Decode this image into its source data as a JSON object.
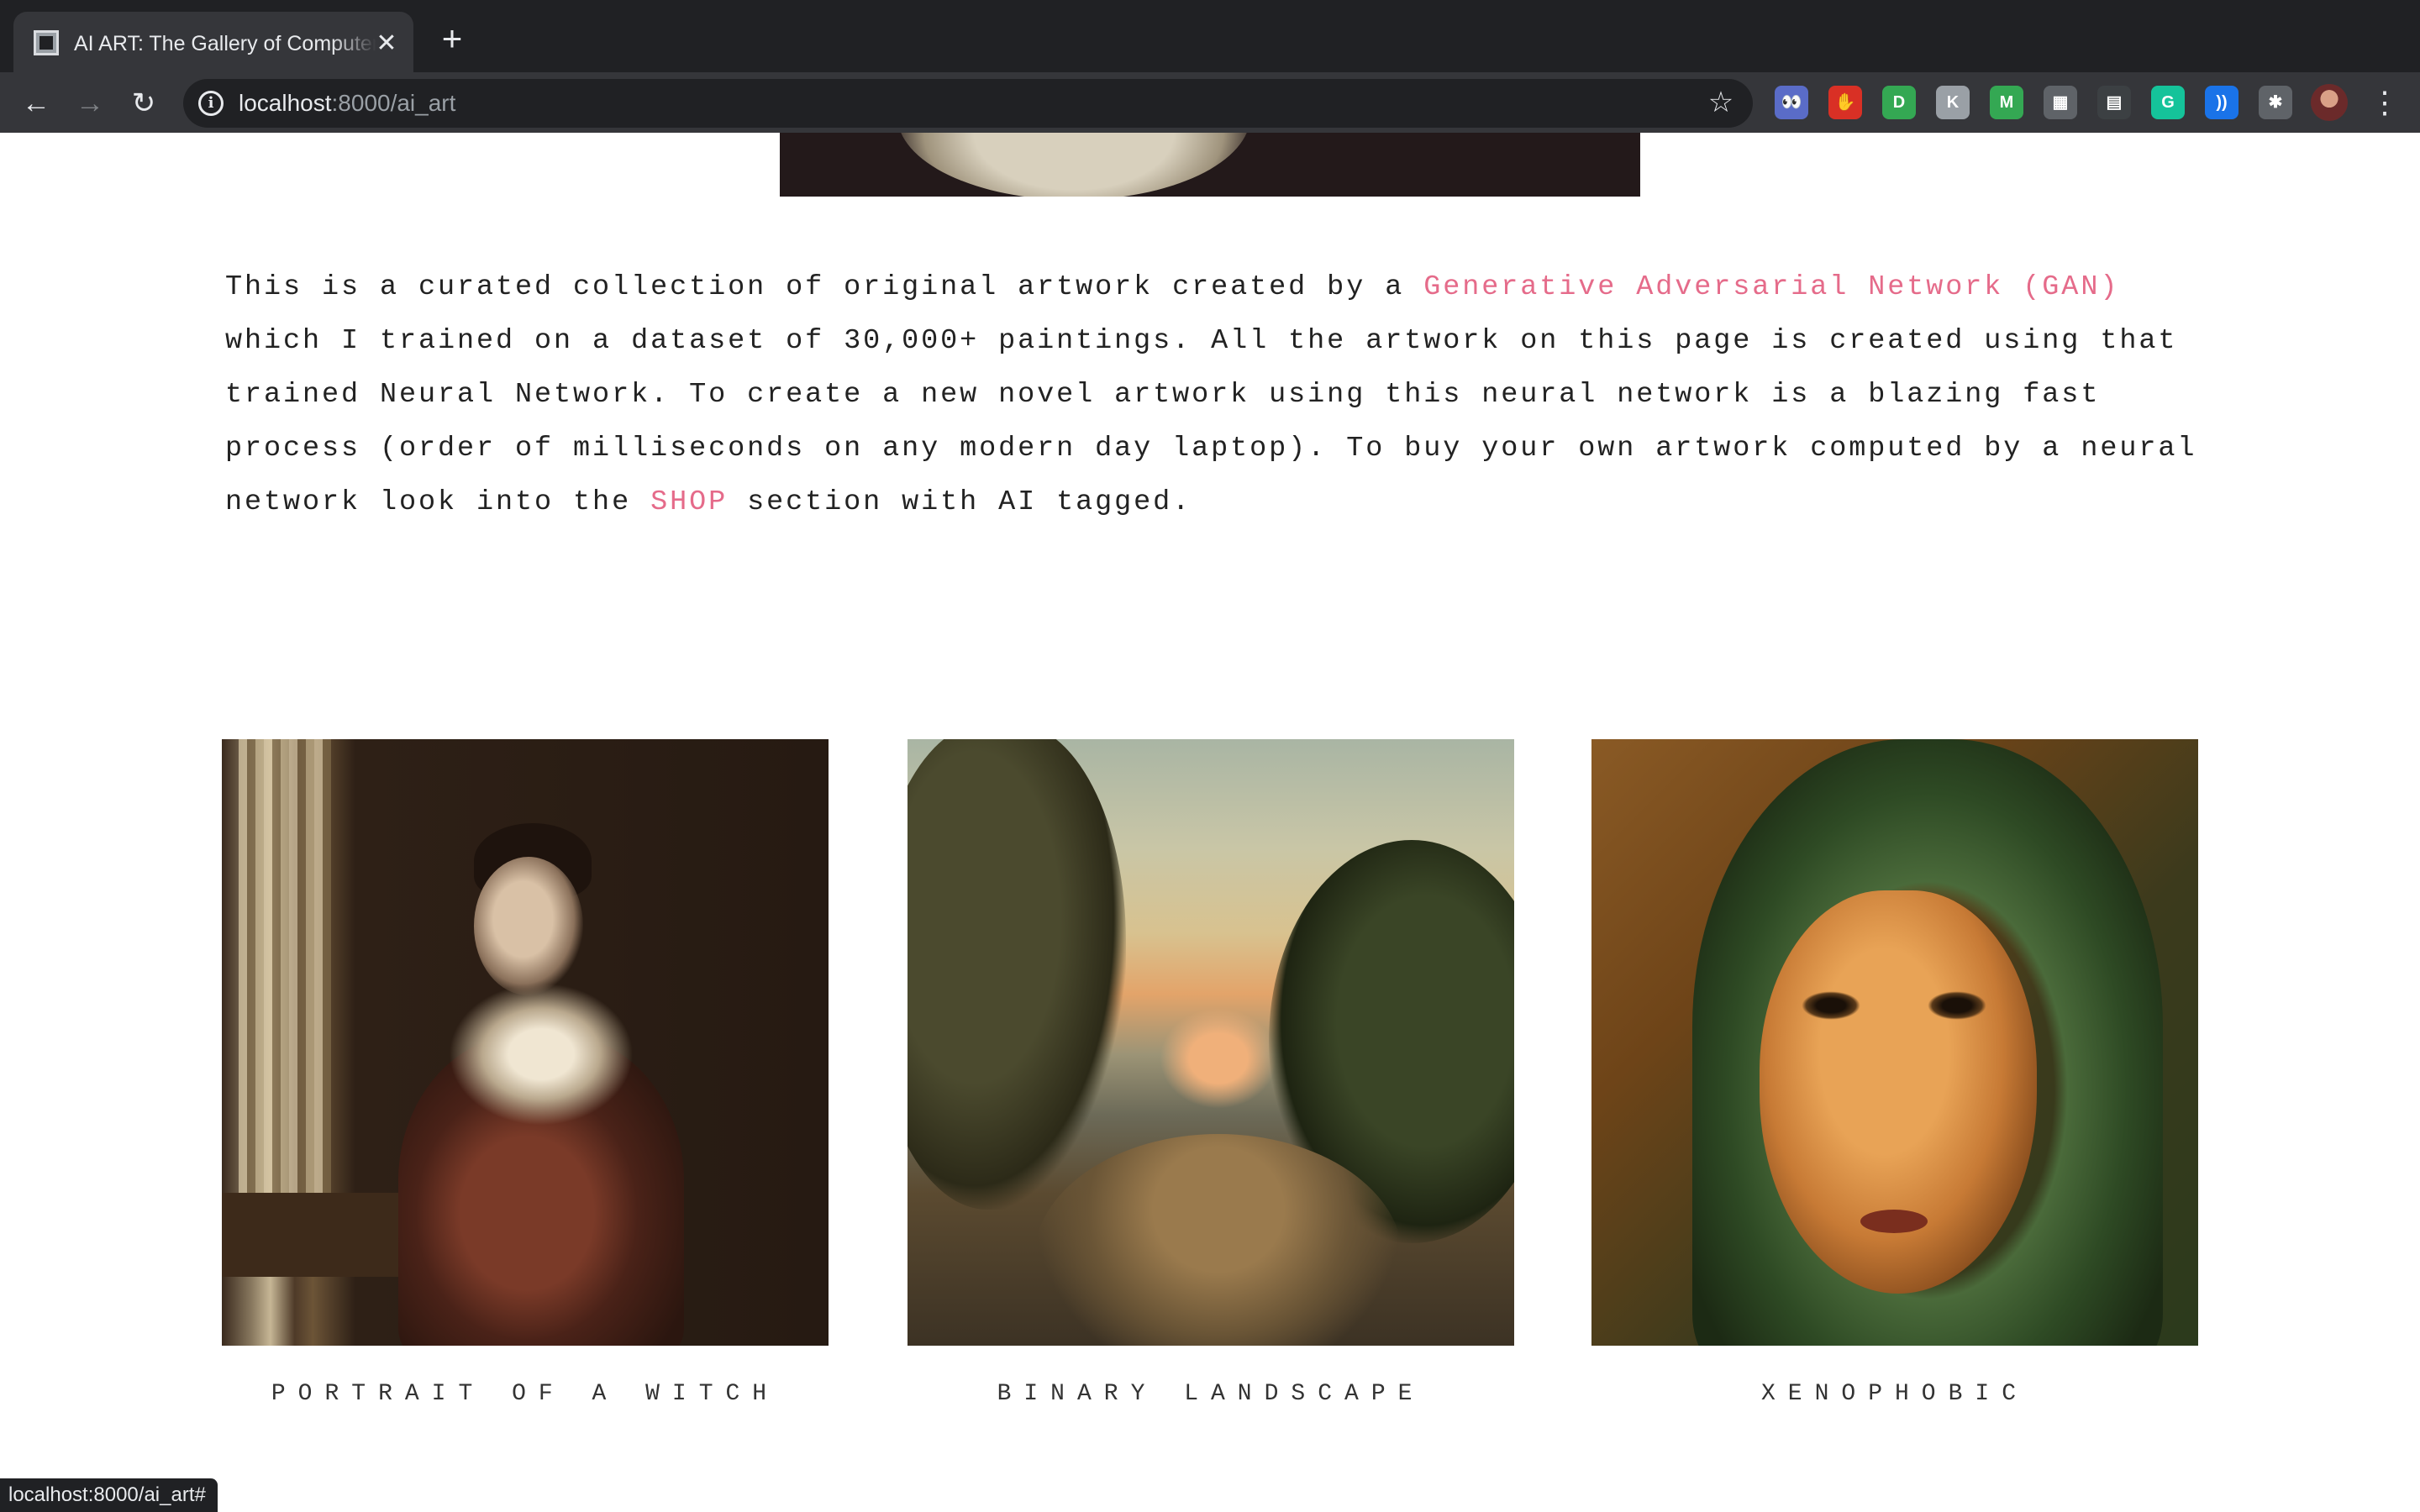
{
  "browser": {
    "tab_title": "AI ART: The Gallery of Computer Generated Art",
    "tab_close": "✕",
    "new_tab": "+",
    "url_host": "localhost",
    "url_path": ":8000/ai_art",
    "nav": {
      "back": "←",
      "forward": "→",
      "reload": "↻"
    },
    "star": "☆",
    "menu": "⋮",
    "extensions": [
      {
        "name": "eyes-extension-icon",
        "glyph": "👀",
        "color": "#5a6cc7"
      },
      {
        "name": "stop-extension-icon",
        "glyph": "✋",
        "color": "#d93025"
      },
      {
        "name": "d-extension-icon",
        "glyph": "D",
        "color": "#34a853"
      },
      {
        "name": "k-extension-icon",
        "glyph": "K",
        "color": "#9aa0a6"
      },
      {
        "name": "m-extension-icon",
        "glyph": "M",
        "color": "#34a853"
      },
      {
        "name": "grid-extension-icon",
        "glyph": "▦",
        "color": "#5f6368"
      },
      {
        "name": "doc-extension-icon",
        "glyph": "▤",
        "color": "#3c4043"
      },
      {
        "name": "grammarly-extension-icon",
        "glyph": "G",
        "color": "#15c39a"
      },
      {
        "name": "sound-extension-icon",
        "glyph": "))",
        "color": "#1a73e8"
      },
      {
        "name": "puzzle-extension-icon",
        "glyph": "✱",
        "color": "#5f6368"
      }
    ]
  },
  "intro": {
    "part1": "This is a curated collection of original artwork created by a ",
    "gan_link": "Generative Adversarial Network (GAN)",
    "part2": " which I trained on a dataset of 30,000+ paintings. All the artwork on this page is created using that trained Neural Network. To create a new novel artwork using this neural network is a blazing fast process (order of milliseconds on any modern day laptop). To buy your own artwork computed by a neural network look into the ",
    "shop_link": "SHOP",
    "part3": " section with AI tagged."
  },
  "gallery": [
    {
      "title": "PORTRAIT OF A WITCH"
    },
    {
      "title": "BINARY LANDSCAPE"
    },
    {
      "title": "XENOPHOBIC"
    }
  ],
  "status_bar": "localhost:8000/ai_art#"
}
